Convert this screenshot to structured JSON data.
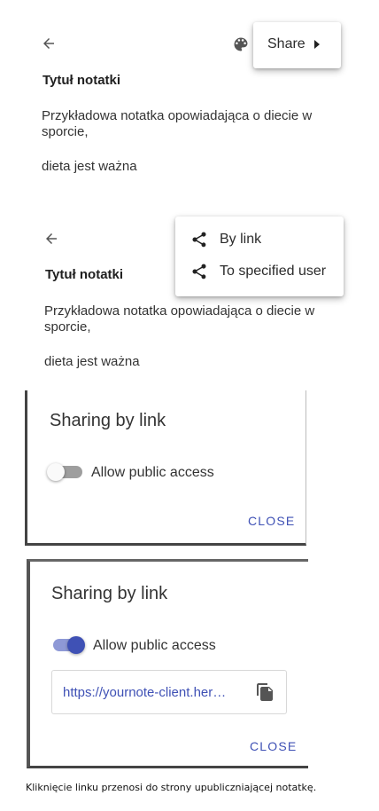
{
  "panel1": {
    "title": "Tytuł notatki",
    "paragraph1": "Przykładowa notatka opowiadająca o diecie w sporcie,",
    "paragraph2": "dieta jest ważna",
    "menu": {
      "share_label": "Share"
    }
  },
  "panel2": {
    "title": "Tytuł notatki",
    "paragraph1": "Przykładowa notatka opowiadająca o diecie w sporcie,",
    "paragraph2": "dieta jest ważna",
    "menu": {
      "items": [
        {
          "label": "By link",
          "icon": "share-icon"
        },
        {
          "label": "To specified user",
          "icon": "share-icon"
        }
      ]
    }
  },
  "dialog1": {
    "title": "Sharing by link",
    "toggle_label": "Allow public access",
    "toggle_on": false,
    "close_label": "CLOSE"
  },
  "dialog2": {
    "title": "Sharing by link",
    "toggle_label": "Allow public access",
    "toggle_on": true,
    "link": "https://yournote-client.her…",
    "close_label": "CLOSE"
  },
  "caption": "Kliknięcie linku przenosi do strony upubliczniającej notatkę.",
  "colors": {
    "accent": "#3f51b5",
    "switch_off_track": "#9e9e9e",
    "switch_off_thumb": "#fafafa",
    "switch_on_track": "#8e99d6"
  }
}
